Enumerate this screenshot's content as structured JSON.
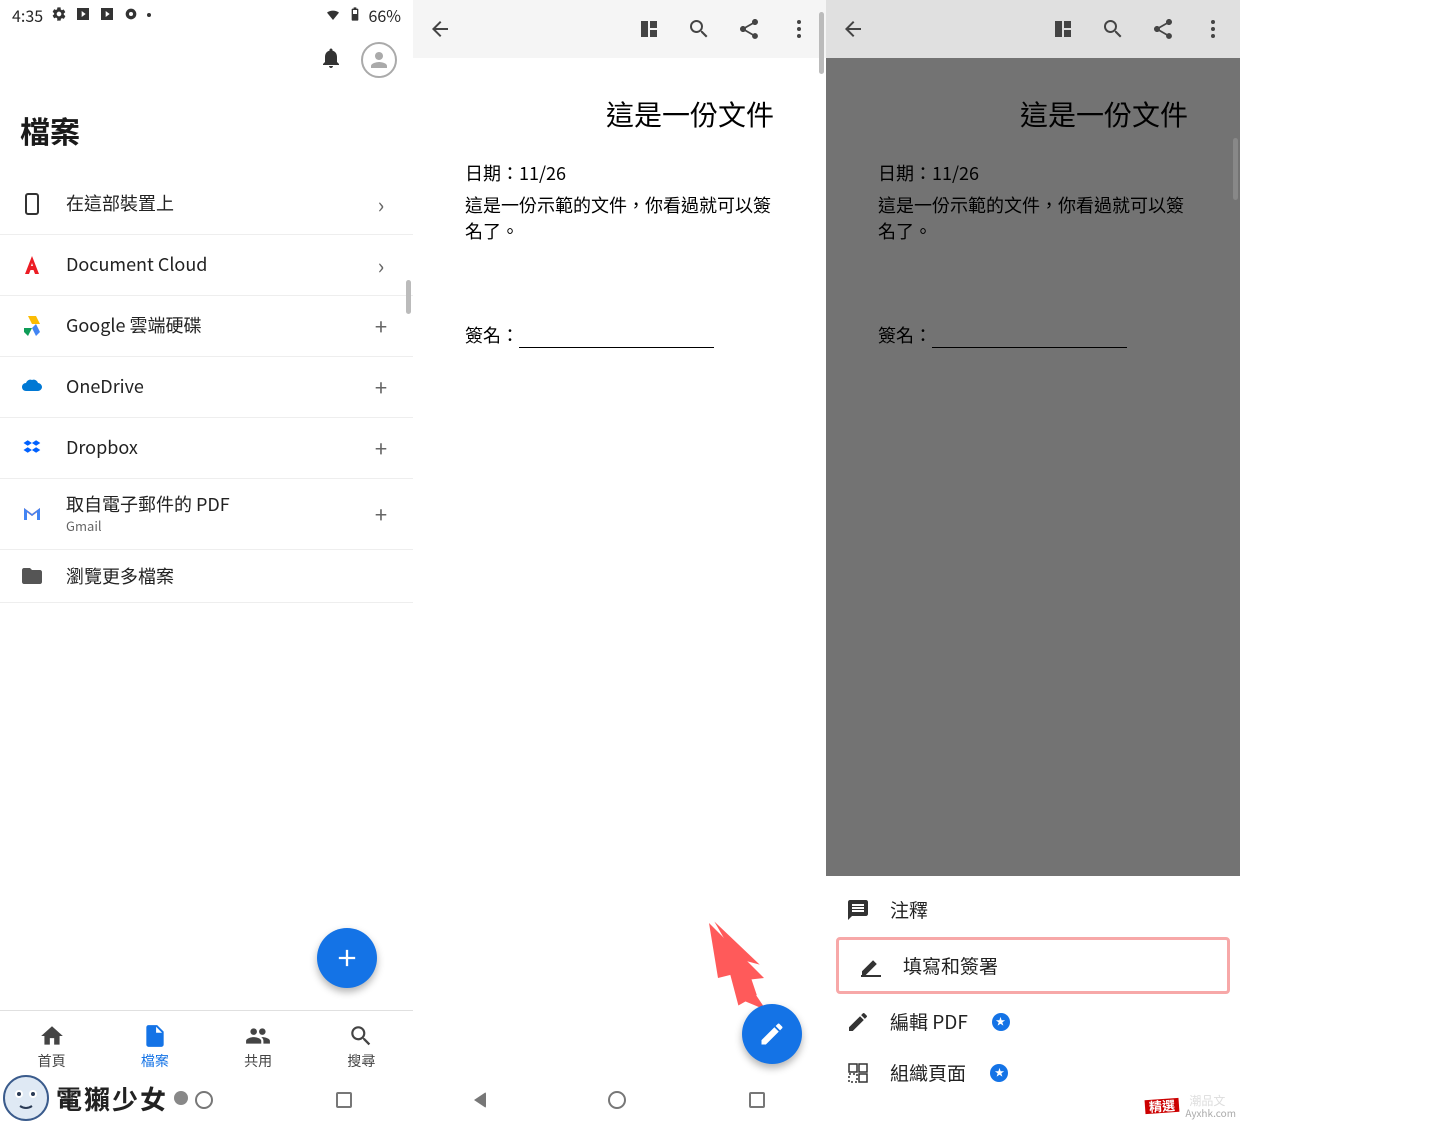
{
  "status": {
    "time": "4:35",
    "battery": "66%"
  },
  "p1": {
    "title": "檔案",
    "items": [
      {
        "label": "在這部裝置上",
        "trail": "chevron"
      },
      {
        "label": "Document Cloud",
        "trail": "chevron"
      },
      {
        "label": "Google 雲端硬碟",
        "trail": "plus"
      },
      {
        "label": "OneDrive",
        "trail": "plus"
      },
      {
        "label": "Dropbox",
        "trail": "plus"
      },
      {
        "label": "取自電子郵件的 PDF",
        "sub": "Gmail",
        "trail": "plus"
      },
      {
        "label": "瀏覽更多檔案",
        "trail": ""
      }
    ],
    "nav": [
      {
        "label": "首頁"
      },
      {
        "label": "檔案"
      },
      {
        "label": "共用"
      },
      {
        "label": "搜尋"
      }
    ]
  },
  "doc": {
    "title": "這是一份文件",
    "date_line": "日期：11/26",
    "body_line": "這是一份示範的文件，你看過就可以簽名了。",
    "sign_label": "簽名："
  },
  "sheet": {
    "items": [
      {
        "label": "注釋",
        "star": false,
        "highlight": false
      },
      {
        "label": "填寫和簽署",
        "star": false,
        "highlight": true
      },
      {
        "label": "編輯 PDF",
        "star": true,
        "highlight": false
      },
      {
        "label": "組織頁面",
        "star": true,
        "highlight": false
      }
    ]
  },
  "watermark": {
    "left": "電獺少女",
    "right1": "潮品文",
    "right2": "Ayxhk.com"
  }
}
